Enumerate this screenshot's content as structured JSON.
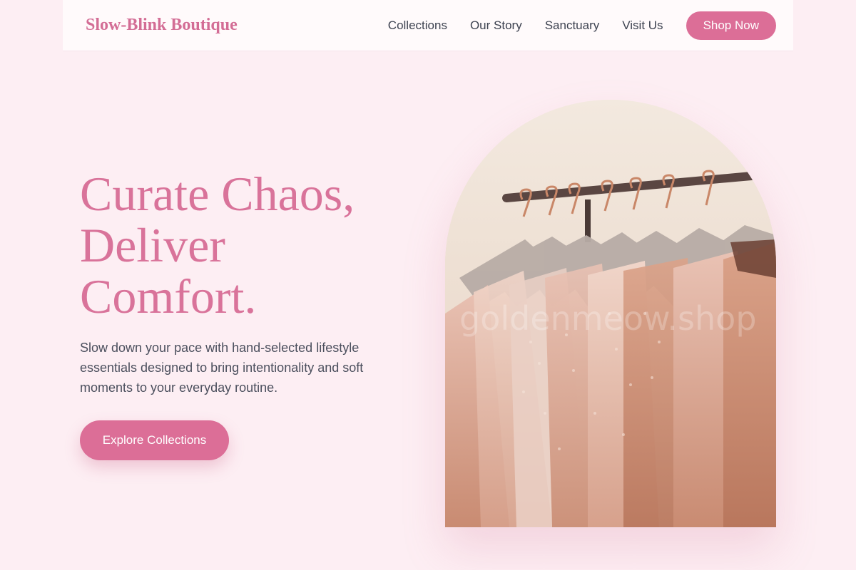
{
  "nav": {
    "brand": "Slow-Blink Boutique",
    "links": [
      "Collections",
      "Our Story",
      "Sanctuary",
      "Visit Us"
    ],
    "cta": "Shop Now"
  },
  "hero": {
    "title_lines": [
      "Curate Chaos,",
      "Deliver",
      "Comfort."
    ],
    "subtitle_lines": [
      "Slow down your pace with hand-selected lifestyle",
      "essentials designed to bring intentionality and soft",
      "moments to your everyday routine."
    ],
    "cta": "Explore Collections",
    "image": {
      "subject": "clothing rack with pink and peach garments on hangers",
      "watermark": "goldenmeow.shop"
    }
  },
  "colors": {
    "background": "#fdeef3",
    "accent": "#dc6e97",
    "heading": "#d9739a",
    "body_text": "#4b4f5d",
    "nav_text": "#3d4250"
  }
}
